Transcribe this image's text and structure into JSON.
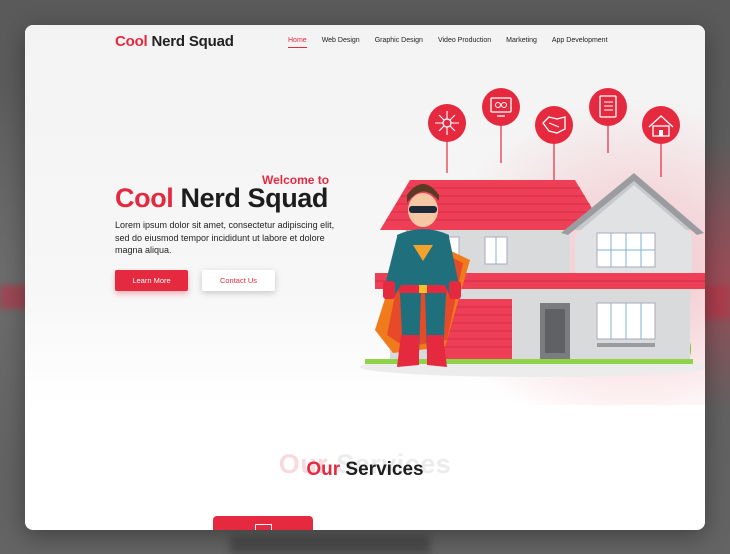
{
  "logo": {
    "first": "Cool",
    "rest": " Nerd Squad"
  },
  "nav": [
    {
      "label": "Home",
      "active": true
    },
    {
      "label": "Web Design"
    },
    {
      "label": "Graphic Design"
    },
    {
      "label": "Video Production"
    },
    {
      "label": "Marketing"
    },
    {
      "label": "App Development"
    }
  ],
  "hero": {
    "welcome": "Welcome to",
    "headline_red": "Cool",
    "headline_rest": " Nerd Squad",
    "text": "Lorem ipsum dolor sit amet, consectetur adipiscing elit, sed do eiusmod tempor incididunt ut labore et dolore magna aliqua.",
    "primary_button": "Learn More",
    "secondary_button": "Contact Us"
  },
  "services": {
    "ghost_red": "Our",
    "ghost_rest": " Services",
    "title_red": "Our",
    "title_rest": " Services"
  },
  "colors": {
    "accent": "#e52a40",
    "text": "#1d1d1d",
    "roof": "#ee3f57",
    "wall": "#d9dadc"
  },
  "icons": [
    "network-icon",
    "monitor-icon",
    "handshake-icon",
    "checklist-icon",
    "house-icon"
  ]
}
